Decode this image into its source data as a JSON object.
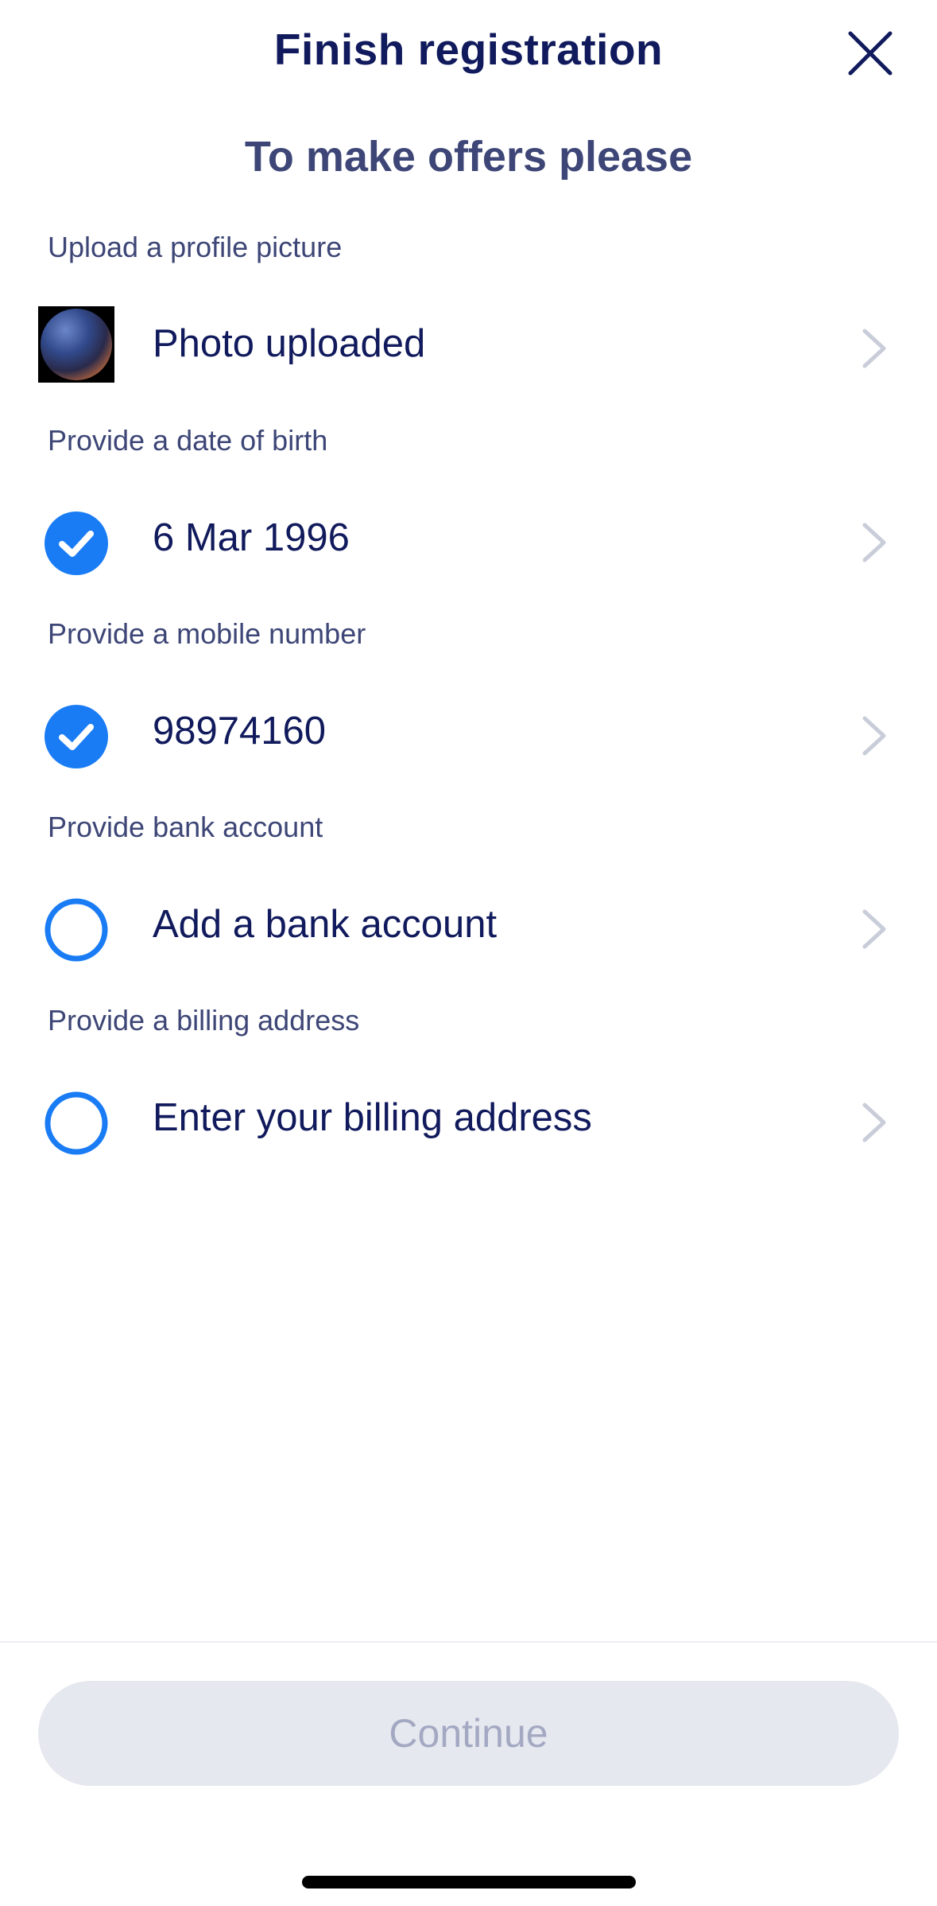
{
  "header": {
    "title": "Finish registration",
    "close_icon": "close-icon"
  },
  "subtitle": "To make offers please",
  "sections": [
    {
      "label": "Upload a profile picture",
      "value": "Photo uploaded",
      "status": "photo",
      "icon": "profile-photo-thumbnail"
    },
    {
      "label": "Provide a date of birth",
      "value": "6 Mar 1996",
      "status": "complete",
      "icon": "check-circle-icon"
    },
    {
      "label": "Provide a mobile number",
      "value": "98974160",
      "status": "complete",
      "icon": "check-circle-icon"
    },
    {
      "label": "Provide bank account",
      "value": "Add a bank account",
      "status": "incomplete",
      "icon": "empty-circle-icon"
    },
    {
      "label": "Provide a billing address",
      "value": "Enter your billing address",
      "status": "incomplete",
      "icon": "empty-circle-icon"
    }
  ],
  "footer": {
    "continue_label": "Continue",
    "continue_enabled": false
  },
  "colors": {
    "accent": "#1a7cf5",
    "title": "#101a5c",
    "label": "#3d4676",
    "chevron": "#c8cdd9",
    "button_bg_disabled": "#e6e8ef",
    "button_text_disabled": "#a3a9c2"
  }
}
